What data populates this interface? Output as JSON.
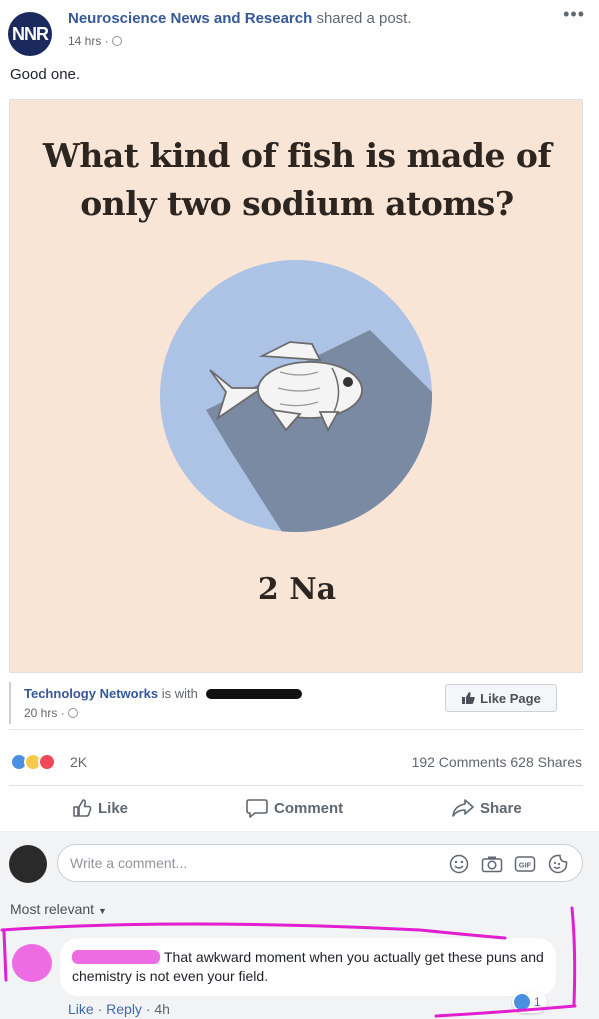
{
  "post": {
    "page_name": "Neuroscience News and Research",
    "action_text": "shared a post.",
    "time": "14 hrs",
    "avatar_text": "NNR",
    "more_icon": "more-options-icon",
    "text": "Good one."
  },
  "shared_card": {
    "question": "What kind of fish is made of only two sodium atoms?",
    "answer": "2 Na",
    "colors": {
      "background": "#f9e5d5",
      "circle": "#adc3e6",
      "shadow": "#7b8aa3"
    }
  },
  "source": {
    "name": "Technology Networks",
    "with_text": "is with",
    "time": "20 hrs",
    "like_page_label": "Like Page"
  },
  "stats": {
    "reaction_count": "2K",
    "reaction_icons": [
      "like-reaction-icon",
      "haha-reaction-icon",
      "love-reaction-icon"
    ],
    "comments": "192 Comments",
    "shares": "628 Shares"
  },
  "actions": {
    "like": "Like",
    "comment": "Comment",
    "share": "Share"
  },
  "composer": {
    "placeholder": "Write a comment...",
    "icons": [
      "emoji-icon",
      "camera-icon",
      "gif-icon",
      "sticker-icon"
    ]
  },
  "comments": {
    "sort_label": "Most relevant",
    "items": [
      {
        "text": "That awkward moment when you actually get these puns and chemistry is not even your field.",
        "like_label": "Like",
        "reply_label": "Reply",
        "time": "4h",
        "reaction_count": "1"
      }
    ]
  },
  "colors": {
    "link": "#365899",
    "accent": "#4267b2",
    "highlight": "#e11fd0"
  }
}
